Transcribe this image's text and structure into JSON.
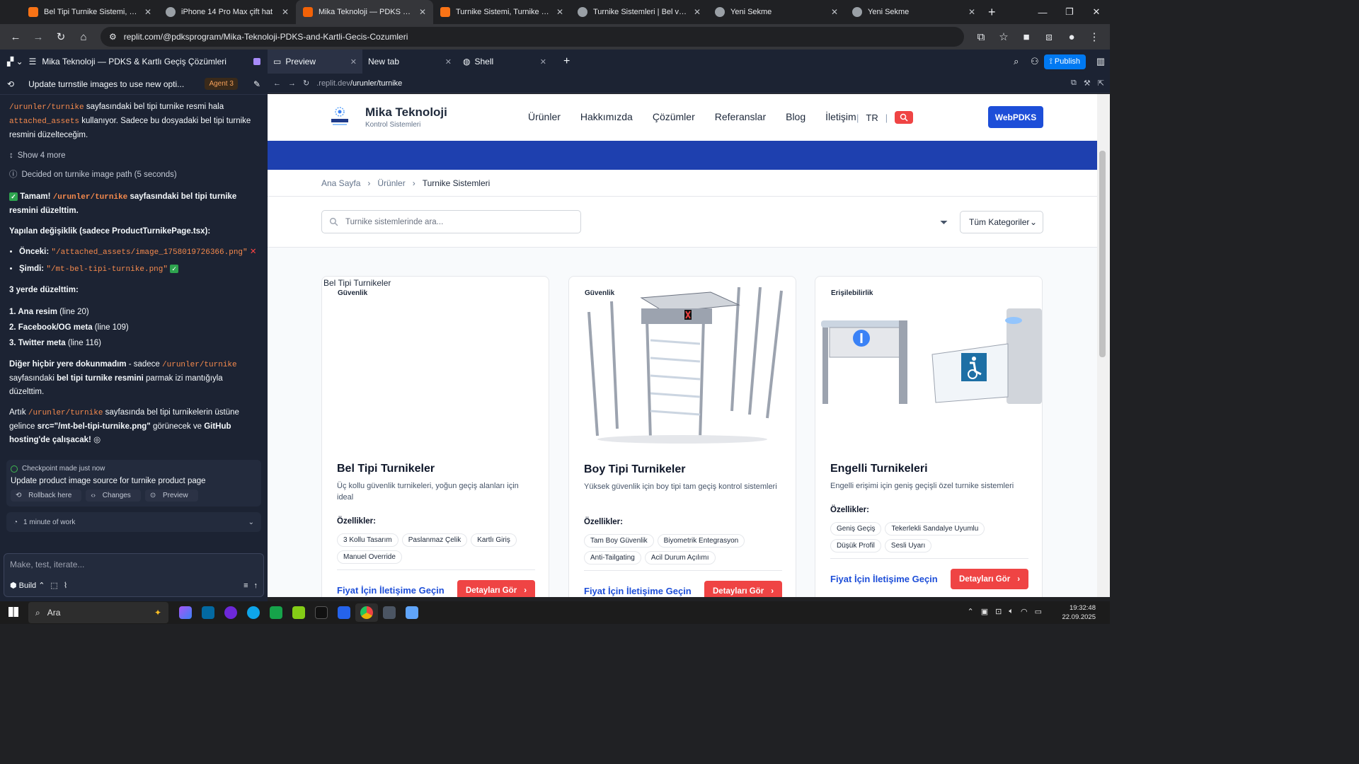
{
  "browser": {
    "tabs": [
      {
        "title": "Bel Tipi Turnike Sistemi, Bel Turnik",
        "color": "#f97316",
        "active": false
      },
      {
        "title": "iPhone 14 Pro Max çift hat",
        "color": "#9aa0a6",
        "active": false
      },
      {
        "title": "Mika Teknoloji — PDKS & Kartlı",
        "color": "#f26207",
        "active": true
      },
      {
        "title": "Turnike Sistemi, Turnike Sistemleri",
        "color": "#f97316",
        "active": false
      },
      {
        "title": "Turnike Sistemleri | Bel ve Boy T",
        "color": "#9aa0a6",
        "active": false
      },
      {
        "title": "Yeni Sekme",
        "color": "#9aa0a6",
        "active": false
      },
      {
        "title": "Yeni Sekme",
        "color": "#9aa0a6",
        "active": false
      }
    ],
    "url": "replit.com/@pdksprogram/Mika-Teknoloji-PDKS-and-Kartli-Gecis-Cozumleri"
  },
  "replit": {
    "project_title": "Mika Teknoloji — PDKS & Kartlı Geçiş Çözümleri",
    "task_title": "Update turnstile images to use new opti...",
    "agent_badge": "Agent 3",
    "panel_tabs": [
      {
        "label": "Preview",
        "active": true
      },
      {
        "label": "New tab",
        "active": false
      },
      {
        "label": "Shell",
        "active": false
      }
    ],
    "publish_label": "Publish",
    "preview_url_prefix": ".replit.dev",
    "preview_url_path": "/urunler/turnike"
  },
  "chat": {
    "p1_code1": "/urunler/turnike",
    "p1_text1": " sayfasındaki bel tipi turnike resmi hala ",
    "p1_code2": "attached_assets",
    "p1_text2": " kullanıyor. Sadece bu dosyadaki bel tipi turnike resmini düzelteceğim.",
    "show_more": "Show 4 more",
    "decided": "Decided on turnike image path (5 seconds)",
    "done_a": "Tamam! ",
    "done_code": "/urunler/turnike",
    "done_b": " sayfasındaki bel tipi turnike resmini düzelttim.",
    "change_heading": "Yapılan değişiklik (sadece ProductTurnikePage.tsx):",
    "before_label": "Önceki:",
    "before_value": "\"/attached_assets/image_1758019726366.png\"",
    "after_label": "Şimdi:",
    "after_value": "\"/mt-bel-tipi-turnike.png\"",
    "fixed_heading": "3 yerde düzelttim:",
    "fixes": [
      {
        "label": "1. Ana resim",
        "line": " (line 20)"
      },
      {
        "label": "2. Facebook/OG meta",
        "line": " (line 109)"
      },
      {
        "label": "3. Twitter meta",
        "line": " (line 116)"
      }
    ],
    "p5_a": "Diğer hiçbir yere dokunmadım",
    "p5_b": " - sadece ",
    "p5_code": "/urunler/turnike",
    "p5_c": " sayfasındaki ",
    "p5_d": "bel tipi turnike resmini",
    "p5_e": " parmak izi mantığıyla düzelttim.",
    "p6_a": "Artık ",
    "p6_code": "/urunler/turnike",
    "p6_b": " sayfasında bel tipi turnikelerin üstüne gelince ",
    "p6_c": "src=\"/mt-bel-tipi-turnike.png\"",
    "p6_d": " görünecek ve ",
    "p6_e": "GitHub hosting'de çalışacak!",
    "checkpoint_status": "Checkpoint made just now",
    "checkpoint_title": "Update product image source for turnike product page",
    "rollback": "Rollback here",
    "changes": "Changes",
    "preview": "Preview",
    "work_time": "1 minute of work",
    "input_placeholder": "Make, test, iterate...",
    "build_label": "Build"
  },
  "site": {
    "brand_name": "Mika Teknoloji",
    "brand_sub": "Kontrol Sistemleri",
    "menu": [
      "Ürünler",
      "Hakkımızda",
      "Çözümler",
      "Referanslar",
      "Blog",
      "İletişim"
    ],
    "lang": "TR",
    "cta": "WebPDKS",
    "breadcrumb": [
      "Ana Sayfa",
      "Ürünler",
      "Turnike Sistemleri"
    ],
    "search_placeholder": "Turnike sistemlerinde ara...",
    "category_select": "Tüm Kategoriler",
    "features_label": "Özellikler:",
    "price_label": "Fiyat İçin İletişime Geçin",
    "details_label": "Detayları Gör",
    "cards": [
      {
        "alt": "Bel Tipi Turnikeler",
        "category": "Güvenlik",
        "title": "Bel Tipi Turnikeler",
        "desc": "Üç kollu güvenlik turnikeleri, yoğun geçiş alanları için ideal",
        "features": [
          "3 Kollu Tasarım",
          "Paslanmaz Çelik",
          "Kartlı Giriş",
          "Manuel Override"
        ]
      },
      {
        "category": "Güvenlik",
        "title": "Boy Tipi Turnikeler",
        "desc": "Yüksek güvenlik için boy tipi tam geçiş kontrol sistemleri",
        "features": [
          "Tam Boy Güvenlik",
          "Biyometrik Entegrasyon",
          "Anti-Tailgating",
          "Acil Durum Açılımı"
        ]
      },
      {
        "category": "Erişilebilirlik",
        "title": "Engelli Turnikeleri",
        "desc": "Engelli erişimi için geniş geçişli özel turnike sistemleri",
        "features": [
          "Geniş Geçiş",
          "Tekerlekli Sandalye Uyumlu",
          "Düşük Profil",
          "Sesli Uyarı"
        ]
      }
    ]
  },
  "taskbar": {
    "search": "Ara",
    "time": "19:32:48",
    "date": "22.09.2025"
  }
}
